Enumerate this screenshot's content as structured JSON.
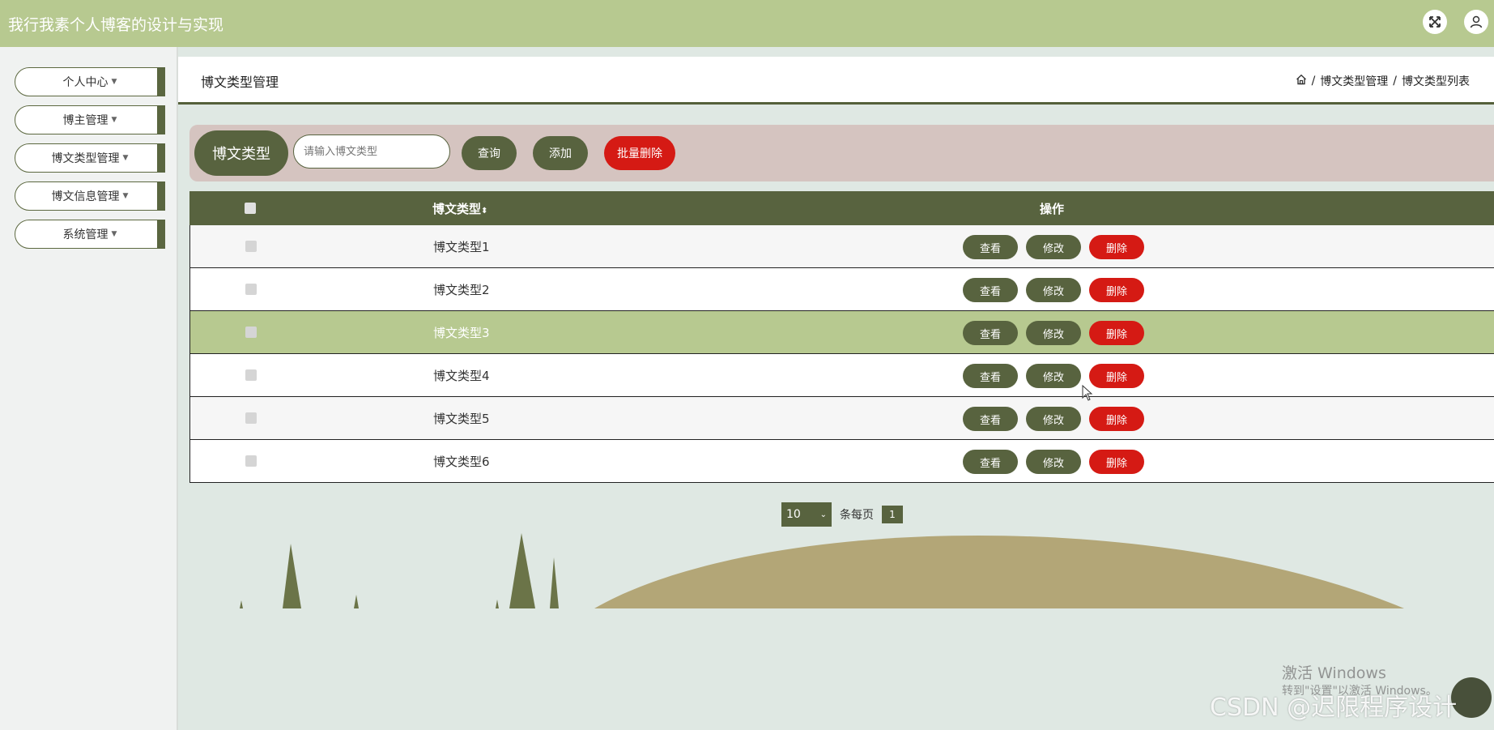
{
  "app": {
    "title": "我行我素个人博客的设计与实现"
  },
  "header_icons": {
    "fullscreen": "expand-icon",
    "user": "user-icon"
  },
  "sidebar": {
    "items": [
      {
        "label": "个人中心"
      },
      {
        "label": "博主管理"
      },
      {
        "label": "博文类型管理"
      },
      {
        "label": "博文信息管理"
      },
      {
        "label": "系统管理"
      }
    ]
  },
  "page": {
    "title": "博文类型管理",
    "breadcrumb": [
      "博文类型管理",
      "博文类型列表"
    ],
    "sep": "/"
  },
  "search": {
    "label": "博文类型",
    "placeholder": "请输入博文类型",
    "query_label": "查询",
    "add_label": "添加",
    "batch_delete_label": "批量删除"
  },
  "table": {
    "col_type": "博文类型",
    "col_ops": "操作",
    "rows": [
      {
        "type": "博文类型1"
      },
      {
        "type": "博文类型2"
      },
      {
        "type": "博文类型3"
      },
      {
        "type": "博文类型4"
      },
      {
        "type": "博文类型5"
      },
      {
        "type": "博文类型6"
      }
    ],
    "view_label": "查看",
    "edit_label": "修改",
    "delete_label": "删除"
  },
  "pagination": {
    "page_size": "10",
    "per_page_label": "条每页",
    "current_page": "1"
  },
  "watermarks": {
    "activate": "激活 Windows",
    "activate_sub": "转到\"设置\"以激活 Windows。",
    "csdn": "CSDN @迟限程序设计"
  },
  "colors": {
    "primary": "#58633f",
    "accent": "#b7c990",
    "danger": "#d51a14"
  }
}
